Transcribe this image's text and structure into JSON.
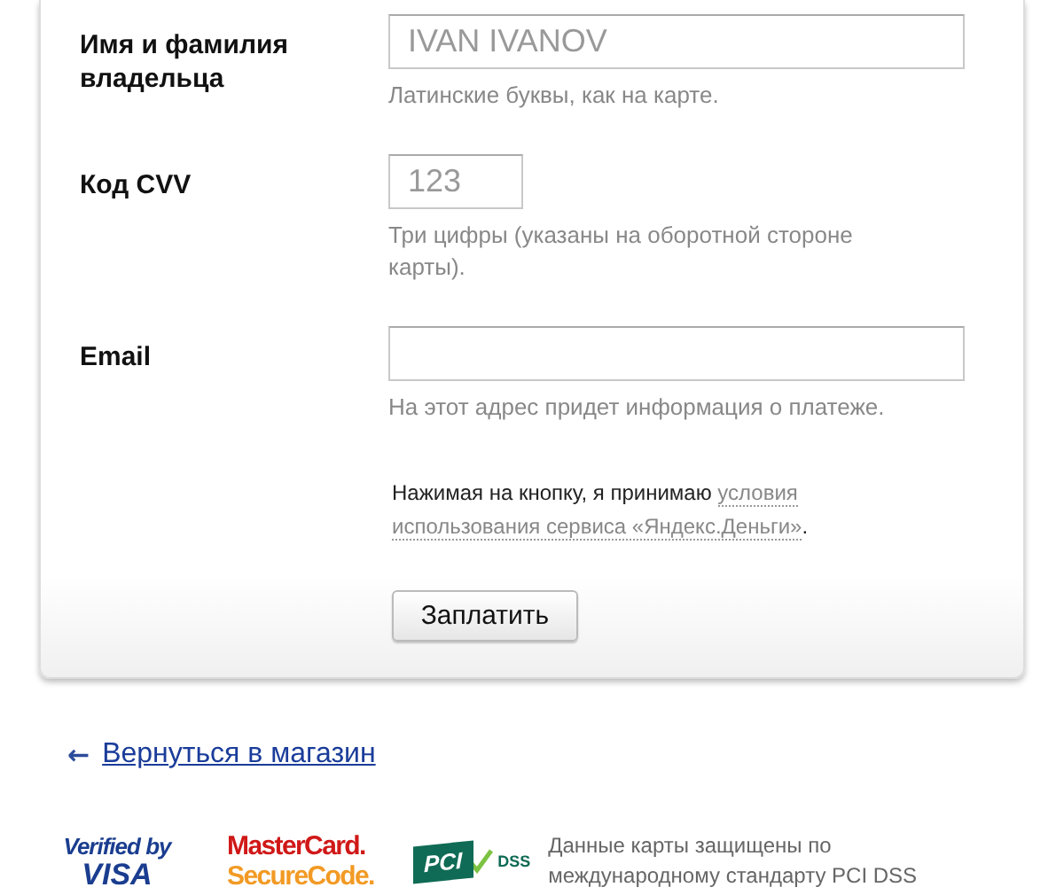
{
  "form": {
    "fields": [
      {
        "label": "Имя и фамилия владельца",
        "placeholder": "IVAN IVANOV",
        "hint": "Латинские буквы, как на карте.",
        "kind": "wide"
      },
      {
        "label": "Код CVV",
        "placeholder": "123",
        "hint": "Три цифры (указаны на оборотной стороне карты).",
        "kind": "short"
      },
      {
        "label": "Email",
        "hint": "На этот адрес придет информация о платеже.",
        "kind": "wide"
      }
    ],
    "terms": {
      "text": "Нажимая на кнопку, я принимаю",
      "link_lines": [
        "условия",
        "использования сервиса «Яндекс.Деньги»"
      ],
      "tail": "."
    },
    "submit": "Заплатить"
  },
  "back_link": {
    "arrow": "←",
    "label": "Вернуться в магазин"
  },
  "badges": {
    "visa": {
      "top": "Verified by",
      "bottom": "VISA"
    },
    "mastercard": {
      "top": "MasterCard.",
      "bottom": "SecureCode."
    },
    "pci": {
      "logo": "PCI",
      "sub": "DSS"
    },
    "text": "Данные карты защищены по международному стандарту PCI DSS"
  }
}
